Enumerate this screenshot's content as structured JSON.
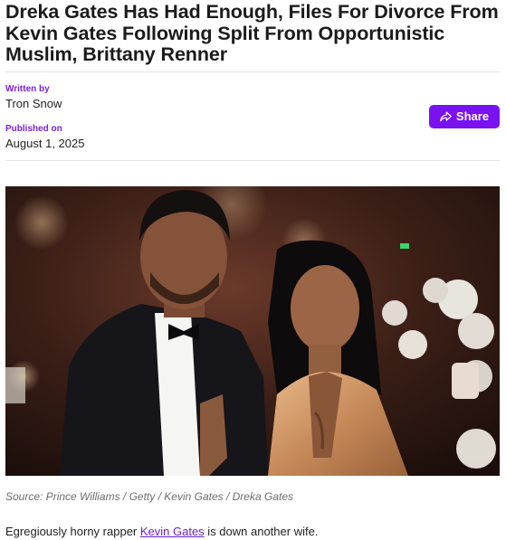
{
  "article": {
    "headline": "Dreka Gates Has Had Enough, Files For Divorce From Kevin Gates Following Split From Opportunistic Muslim, Brittany Renner",
    "written_by_label": "Written by",
    "author": "Tron Snow",
    "published_label": "Published on",
    "published_date": "August 1, 2025",
    "share_label": "Share",
    "share_icon": "share-arrow-icon",
    "image_caption": "Source: Prince Williams / Getty / Kevin Gates / Dreka Gates",
    "body_before_link": "Egregiously horny rapper ",
    "body_link": "Kevin Gates",
    "body_after_link": " is down another wife."
  },
  "colors": {
    "accent": "#7a12f0",
    "link": "#6a1fd6",
    "caption": "#6d6d6d"
  }
}
